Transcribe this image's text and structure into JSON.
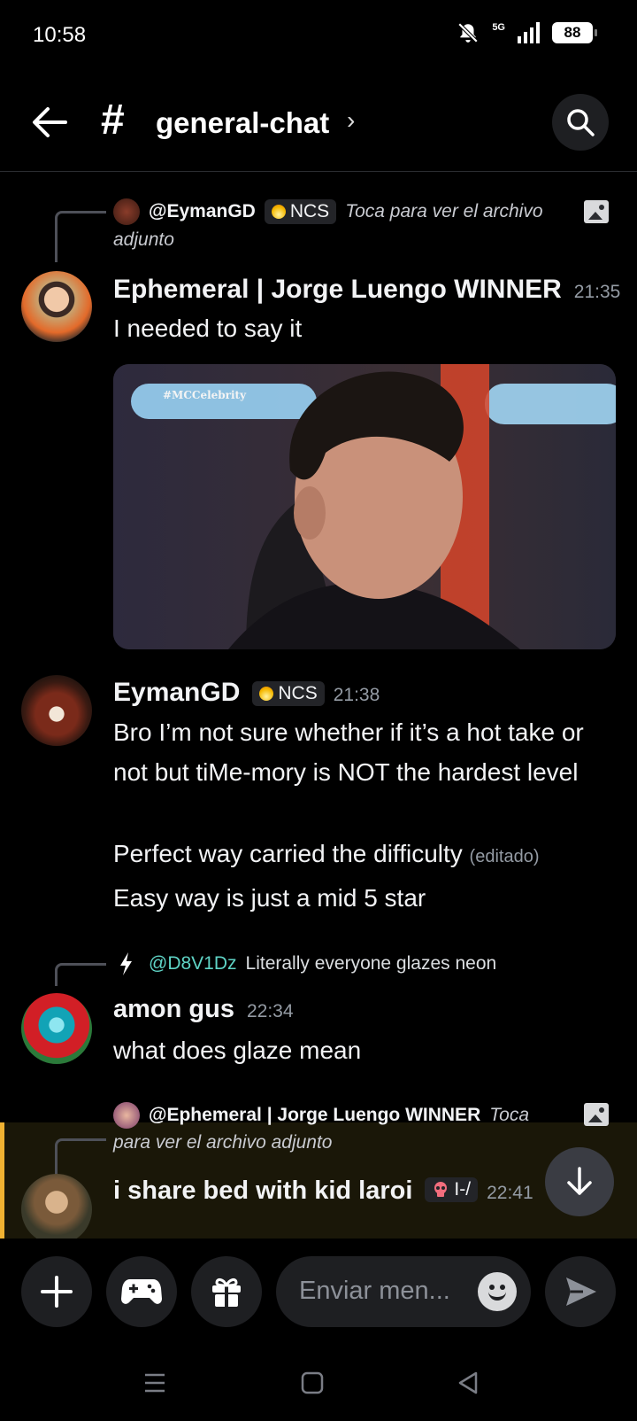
{
  "status": {
    "time": "10:58",
    "battery": "88",
    "network": "5G"
  },
  "header": {
    "channel": "general-chat",
    "hash": "#",
    "chevron": "›"
  },
  "messages": [
    {
      "reply": {
        "user": "@EymanGD",
        "tag": "NCS",
        "text": "Toca para ver el archivo",
        "text2": "adjunto"
      },
      "author": "Ephemeral | Jorge Luengo WINNER",
      "time": "21:35",
      "lines": [
        "I needed to say it"
      ],
      "embed_watermark": "#MCCelebrity"
    },
    {
      "author": "EymanGD",
      "tag": "NCS",
      "time": "21:38",
      "lines": [
        "Bro I’m not sure whether if it’s a hot take or not but tiMe-mory is NOT the hardest level",
        "Perfect way carried the difficulty",
        "Easy way is just a mid 5 star"
      ],
      "edited": "(editado)"
    },
    {
      "reply": {
        "user": "@D8V1Dz",
        "text": "Literally everyone glazes neon"
      },
      "author": "amon gus",
      "time": "22:34",
      "lines": [
        "what does glaze mean"
      ]
    },
    {
      "reply": {
        "user": "@Ephemeral | Jorge Luengo WINNER",
        "text": "Toca",
        "text2": "para ver el archivo adjunto"
      },
      "author": "i share bed with kid laroi",
      "tag": "I-/",
      "time": "22:41"
    }
  ],
  "composer": {
    "placeholder": "Enviar men..."
  },
  "colors": {
    "background": "#000000",
    "surface": "#1e1f22",
    "mention_highlight": "#f0b232",
    "teal_name": "#5fd4c6"
  }
}
